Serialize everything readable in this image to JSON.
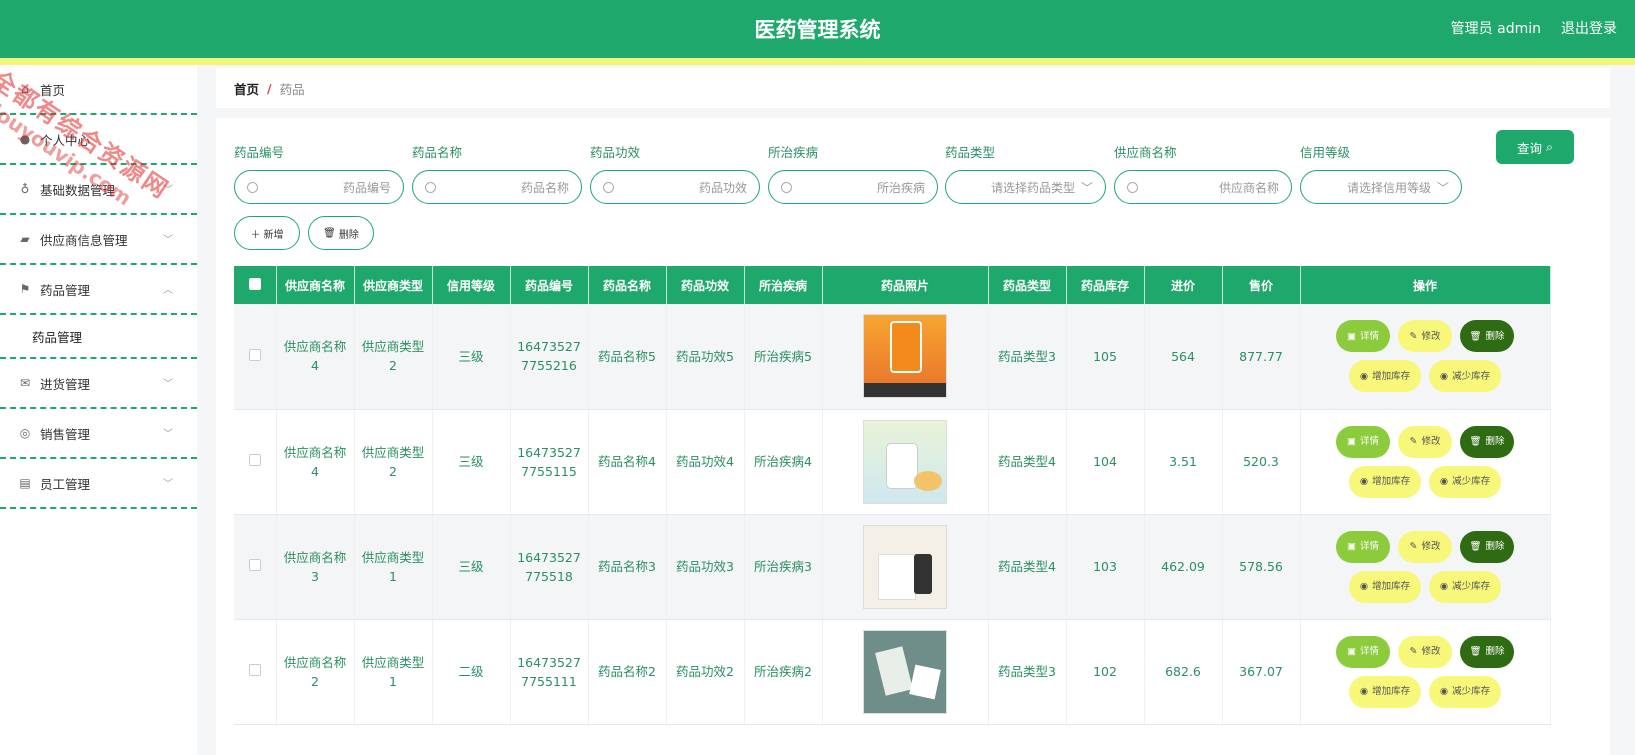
{
  "header": {
    "title": "医药管理系统",
    "user_label": "管理员 admin",
    "logout_label": "退出登录"
  },
  "watermark": {
    "line1": "全都有综合资源网",
    "line2": "douyouvip.com"
  },
  "sidebar": {
    "items": [
      {
        "label": "首页",
        "icon": "home-icon"
      },
      {
        "label": "个人中心",
        "icon": "user-icon"
      },
      {
        "label": "基础数据管理",
        "icon": "mic-icon"
      },
      {
        "label": "供应商信息管理",
        "icon": "truck-icon"
      },
      {
        "label": "药品管理",
        "icon": "flag-icon"
      },
      {
        "label": "进货管理",
        "icon": "mail-icon"
      },
      {
        "label": "销售管理",
        "icon": "target-icon"
      },
      {
        "label": "员工管理",
        "icon": "briefcase-icon"
      }
    ],
    "sub_item": "药品管理"
  },
  "breadcrumb": {
    "home": "首页",
    "separator": "/",
    "current": "药品"
  },
  "filters": {
    "labels": [
      "药品编号",
      "药品名称",
      "药品功效",
      "所治疾病",
      "药品类型",
      "供应商名称",
      "信用等级"
    ],
    "placeholders": [
      "药品编号",
      "药品名称",
      "药品功效",
      "所治疾病",
      "请选择药品类型",
      "供应商名称",
      "请选择信用等级"
    ],
    "query_label": "查询",
    "add_label": "新增",
    "delete_label": "删除"
  },
  "table": {
    "headers": [
      "供应商名称",
      "供应商类型",
      "信用等级",
      "药品编号",
      "药品名称",
      "药品功效",
      "所治疾病",
      "药品照片",
      "药品类型",
      "药品库存",
      "进价",
      "售价",
      "操作"
    ],
    "ops": {
      "detail": "详情",
      "edit": "修改",
      "delete": "删除",
      "add_stock": "增加库存",
      "reduce_stock": "减少库存"
    },
    "rows": [
      {
        "supplier_name": [
          "供应商名称",
          "4"
        ],
        "supplier_type": [
          "供应商类型",
          "2"
        ],
        "credit": "三级",
        "code": [
          "16473527",
          "7755216"
        ],
        "name": "药品名称5",
        "effect": "药品功效5",
        "disease": "所治疾病5",
        "type": "药品类型3",
        "stock": "105",
        "cost": "564",
        "price": "877.77"
      },
      {
        "supplier_name": [
          "供应商名称",
          "4"
        ],
        "supplier_type": [
          "供应商类型",
          "2"
        ],
        "credit": "三级",
        "code": [
          "16473527",
          "7755115"
        ],
        "name": "药品名称4",
        "effect": "药品功效4",
        "disease": "所治疾病4",
        "type": "药品类型4",
        "stock": "104",
        "cost": "3.51",
        "price": "520.3"
      },
      {
        "supplier_name": [
          "供应商名称",
          "3"
        ],
        "supplier_type": [
          "供应商类型",
          "1"
        ],
        "credit": "三级",
        "code": [
          "16473527",
          "775518"
        ],
        "name": "药品名称3",
        "effect": "药品功效3",
        "disease": "所治疾病3",
        "type": "药品类型4",
        "stock": "103",
        "cost": "462.09",
        "price": "578.56"
      },
      {
        "supplier_name": [
          "供应商名称",
          "2"
        ],
        "supplier_type": [
          "供应商类型",
          "1"
        ],
        "credit": "二级",
        "code": [
          "16473527",
          "7755111"
        ],
        "name": "药品名称2",
        "effect": "药品功效2",
        "disease": "所治疾病2",
        "type": "药品类型3",
        "stock": "102",
        "cost": "682.6",
        "price": "367.07"
      }
    ]
  },
  "colors": {
    "primary": "#1ea86c",
    "stripe": "#f3f57a",
    "detail": "#8ccc3c",
    "edit": "#f7f77a",
    "delete": "#2f6b12"
  }
}
